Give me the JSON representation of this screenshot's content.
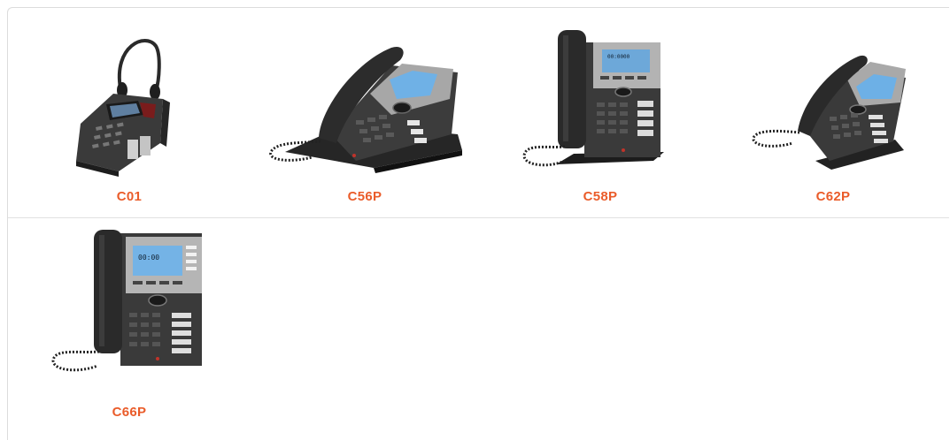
{
  "colors": {
    "accent": "#ea5c2a",
    "border": "#dcdcdc"
  },
  "products": [
    {
      "model": "C01",
      "icon": "headset-call-center-phone-icon"
    },
    {
      "model": "C56P",
      "icon": "desk-ip-phone-icon"
    },
    {
      "model": "C58P",
      "icon": "upright-ip-phone-icon"
    },
    {
      "model": "C62P",
      "icon": "angled-ip-phone-icon"
    },
    {
      "model": "C66P",
      "icon": "upright-ip-phone-icon"
    }
  ]
}
